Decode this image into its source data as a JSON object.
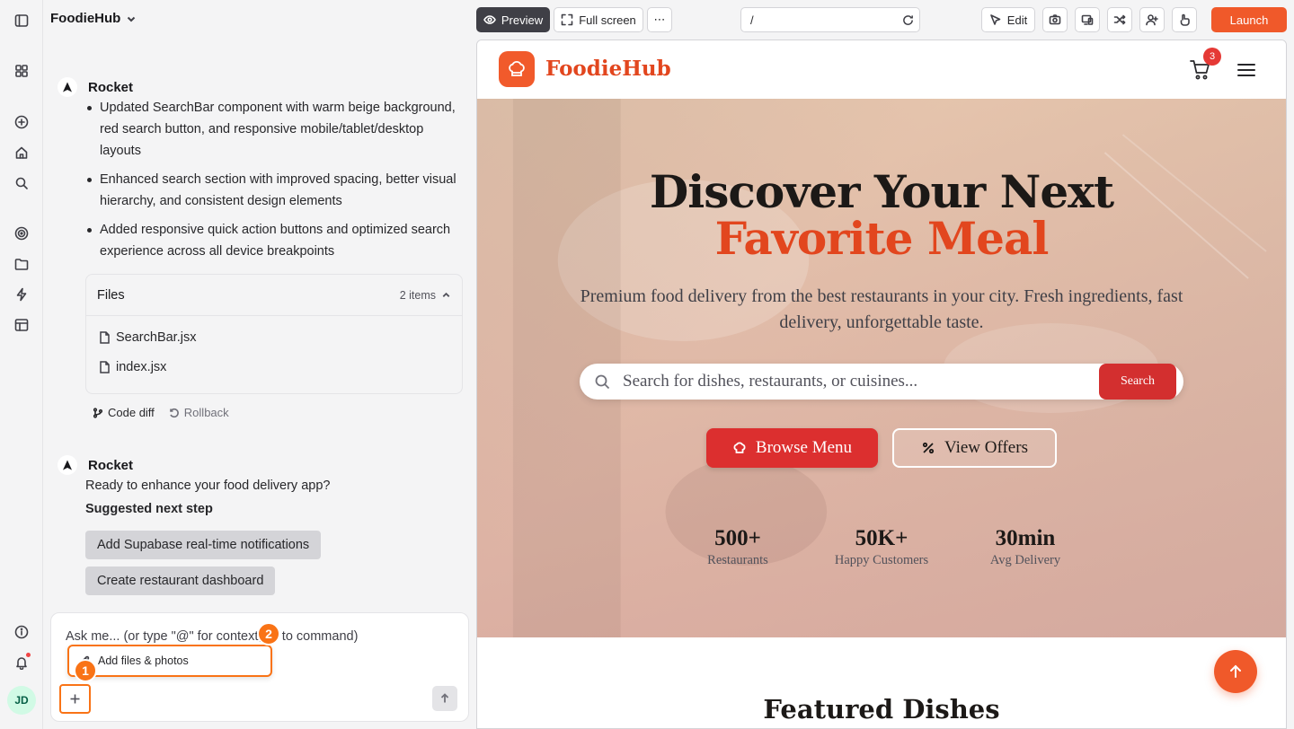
{
  "app": {
    "project_name": "FoodieHub"
  },
  "rail": {
    "icons": [
      "sidebar-toggle-icon",
      "apps-grid-icon",
      "new-chat-icon",
      "home-icon",
      "search-icon",
      "target-icon",
      "folder-icon",
      "bolt-icon",
      "layout-icon",
      "info-icon",
      "bell-icon"
    ],
    "avatar_initials": "JD"
  },
  "chat": {
    "messages": [
      {
        "author": "Rocket",
        "bullets": [
          "Updated SearchBar component with warm beige background, red search button, and responsive mobile/tablet/desktop layouts",
          "Enhanced search section with improved spacing, better visual hierarchy, and consistent design elements",
          "Added responsive quick action buttons and optimized search experience across all device breakpoints"
        ],
        "files": {
          "title": "Files",
          "count": "2 items",
          "items": [
            "SearchBar.jsx",
            "index.jsx"
          ]
        },
        "actions": {
          "code_diff": "Code diff",
          "rollback": "Rollback"
        }
      },
      {
        "author": "Rocket",
        "text": "Ready to enhance your food delivery app?",
        "suggest_title": "Suggested next step",
        "suggestions": [
          "Add Supabase real-time notifications",
          "Create restaurant dashboard"
        ]
      }
    ],
    "composer": {
      "placeholder": "Ask me... (or type \"@\" for context, \"/\" to command)",
      "popup_item": "Add files & photos",
      "step_markers": [
        "1",
        "2"
      ]
    }
  },
  "toolbar": {
    "preview": "Preview",
    "fullscreen": "Full screen",
    "more": "⋯",
    "url": "/",
    "edit": "Edit",
    "launch": "Launch"
  },
  "site": {
    "brand": "FoodieHub",
    "cart_count": "3",
    "hero": {
      "title_line1": "Discover Your Next",
      "title_line2": "Favorite Meal",
      "subtitle": "Premium food delivery from the best restaurants in your city. Fresh ingredients, fast delivery, unforgettable taste.",
      "search_placeholder": "Search for dishes, restaurants, or cuisines...",
      "search_button": "Search",
      "browse_button": "Browse Menu",
      "offers_button": "View Offers"
    },
    "stats": [
      {
        "value": "500+",
        "label": "Restaurants"
      },
      {
        "value": "50K+",
        "label": "Happy Customers"
      },
      {
        "value": "30min",
        "label": "Avg Delivery"
      }
    ],
    "featured_title": "Featured Dishes"
  },
  "colors": {
    "accent": "#f0592a",
    "brand_red": "#dc2f2f",
    "annotation": "#f97316"
  }
}
